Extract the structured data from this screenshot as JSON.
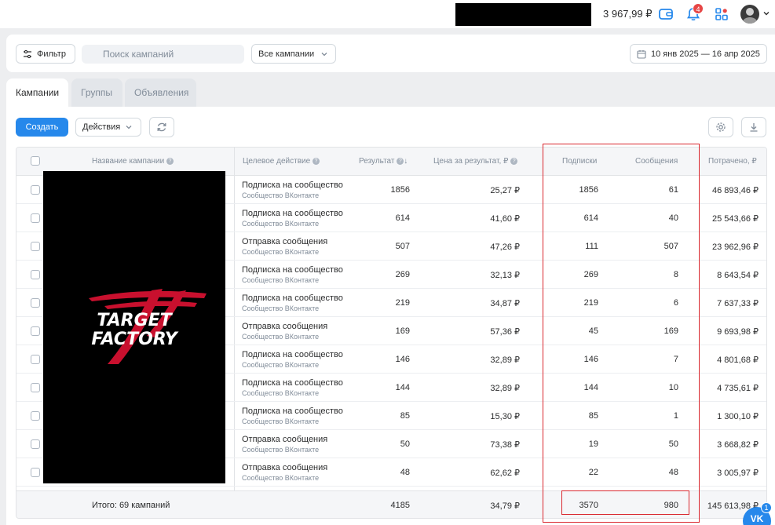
{
  "topbar": {
    "balance": "3 967,99 ₽",
    "notifications_count": "4",
    "icons": [
      "wallet-icon",
      "bell-icon",
      "apps-icon",
      "avatar",
      "chevron-down-icon"
    ]
  },
  "filters": {
    "filter_label": "Фильтр",
    "search_placeholder": "Поиск кампаний",
    "campaigns_select": "Все кампании",
    "date_range": "10 янв 2025 — 16 апр 2025"
  },
  "tabs": [
    {
      "label": "Кампании",
      "active": true
    },
    {
      "label": "Группы",
      "active": false
    },
    {
      "label": "Объявления",
      "active": false
    }
  ],
  "toolbar": {
    "create_label": "Создать",
    "actions_label": "Действия"
  },
  "table": {
    "headers": {
      "name": "Название кампании",
      "target": "Целевое действие",
      "result": "Результат",
      "cost": "Цена за результат, ₽",
      "subs": "Подписки",
      "msgs": "Сообщения",
      "spent": "Потрачено, ₽"
    },
    "rows": [
      {
        "action": "Подписка на сообщество",
        "source": "Сообщество ВКонтакте",
        "result": "1856",
        "cost": "25,27 ₽",
        "subs": "1856",
        "msgs": "61",
        "spent": "46 893,46 ₽"
      },
      {
        "action": "Подписка на сообщество",
        "source": "Сообщество ВКонтакте",
        "result": "614",
        "cost": "41,60 ₽",
        "subs": "614",
        "msgs": "40",
        "spent": "25 543,66 ₽"
      },
      {
        "action": "Отправка сообщения",
        "source": "Сообщество ВКонтакте",
        "result": "507",
        "cost": "47,26 ₽",
        "subs": "111",
        "msgs": "507",
        "spent": "23 962,96 ₽"
      },
      {
        "action": "Подписка на сообщество",
        "source": "Сообщество ВКонтакте",
        "result": "269",
        "cost": "32,13 ₽",
        "subs": "269",
        "msgs": "8",
        "spent": "8 643,54 ₽"
      },
      {
        "action": "Подписка на сообщество",
        "source": "Сообщество ВКонтакте",
        "result": "219",
        "cost": "34,87 ₽",
        "subs": "219",
        "msgs": "6",
        "spent": "7 637,33 ₽"
      },
      {
        "action": "Отправка сообщения",
        "source": "Сообщество ВКонтакте",
        "result": "169",
        "cost": "57,36 ₽",
        "subs": "45",
        "msgs": "169",
        "spent": "9 693,98 ₽"
      },
      {
        "action": "Подписка на сообщество",
        "source": "Сообщество ВКонтакте",
        "result": "146",
        "cost": "32,89 ₽",
        "subs": "146",
        "msgs": "7",
        "spent": "4 801,68 ₽"
      },
      {
        "action": "Подписка на сообщество",
        "source": "Сообщество ВКонтакте",
        "result": "144",
        "cost": "32,89 ₽",
        "subs": "144",
        "msgs": "10",
        "spent": "4 735,61 ₽"
      },
      {
        "action": "Подписка на сообщество",
        "source": "Сообщество ВКонтакте",
        "result": "85",
        "cost": "15,30 ₽",
        "subs": "85",
        "msgs": "1",
        "spent": "1 300,10 ₽"
      },
      {
        "action": "Отправка сообщения",
        "source": "Сообщество ВКонтакте",
        "result": "50",
        "cost": "73,38 ₽",
        "subs": "19",
        "msgs": "50",
        "spent": "3 668,82 ₽"
      },
      {
        "action": "Отправка сообщения",
        "source": "Сообщество ВКонтакте",
        "result": "48",
        "cost": "62,62 ₽",
        "subs": "22",
        "msgs": "48",
        "spent": "3 005,97 ₽"
      }
    ],
    "totals": {
      "label": "Итого: 69 кампаний",
      "result": "4185",
      "cost": "34,79 ₽",
      "subs": "3570",
      "msgs": "980",
      "spent": "145 613,98 ₽"
    }
  },
  "logo": {
    "line1": "TARGET",
    "line2": "FACTORY"
  },
  "vk_widget": {
    "label": "VK",
    "badge": "1"
  },
  "colors": {
    "accent": "#2688eb",
    "highlight": "#d9272e",
    "badge": "#e64646"
  }
}
